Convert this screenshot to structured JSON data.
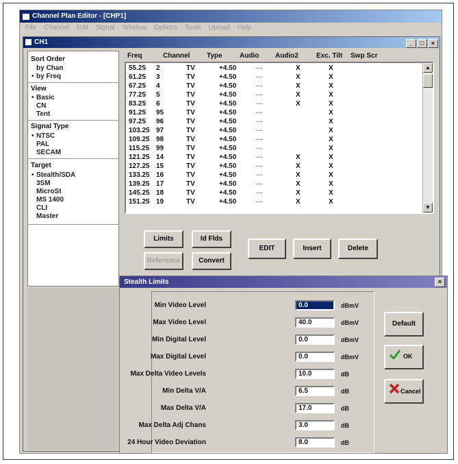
{
  "app": {
    "title": "Channel Plan Editor - [CHP1]",
    "menu": [
      "File",
      "Channel",
      "Edit",
      "Signal",
      "Window",
      "Options",
      "Tools",
      "Upload",
      "Help"
    ]
  },
  "child": {
    "title": "CH1"
  },
  "left_panel": {
    "sort_order": {
      "label": "Sort Order",
      "options": [
        "by Chan",
        "by Freq"
      ],
      "selected": "by Freq"
    },
    "view": {
      "label": "View",
      "options": [
        "Basic",
        "CN",
        "Tent"
      ],
      "selected": "Basic"
    },
    "signal_type": {
      "label": "Signal Type",
      "options": [
        "NTSC",
        "PAL",
        "SECAM"
      ],
      "selected": "NTSC"
    },
    "target": {
      "label": "Target",
      "options": [
        "Stealth/SDA",
        "3SM",
        "MicroSt",
        "MS 1400",
        "CLI",
        "Master"
      ],
      "selected": "Stealth/SDA"
    }
  },
  "table": {
    "columns": [
      "Freq",
      "Channel",
      "Type",
      "Audio",
      "Audio2",
      "Exc. Tilt",
      "Swp Scr"
    ],
    "rows": [
      [
        "55.25",
        "2",
        "TV",
        "+4.50",
        "---",
        "X",
        "X"
      ],
      [
        "61.25",
        "3",
        "TV",
        "+4.50",
        "---",
        "X",
        "X"
      ],
      [
        "67.25",
        "4",
        "TV",
        "+4.50",
        "---",
        "X",
        "X"
      ],
      [
        "77.25",
        "5",
        "TV",
        "+4.50",
        "---",
        "X",
        "X"
      ],
      [
        "83.25",
        "6",
        "TV",
        "+4.50",
        "---",
        "X",
        "X"
      ],
      [
        "91.25",
        "95",
        "TV",
        "+4.50",
        "---",
        "",
        "X"
      ],
      [
        "97.25",
        "96",
        "TV",
        "+4.50",
        "---",
        "",
        "X"
      ],
      [
        "103.25",
        "97",
        "TV",
        "+4.50",
        "---",
        "",
        "X"
      ],
      [
        "109.25",
        "98",
        "TV",
        "+4.50",
        "---",
        "",
        "X"
      ],
      [
        "115.25",
        "99",
        "TV",
        "+4.50",
        "---",
        "",
        "X"
      ],
      [
        "121.25",
        "14",
        "TV",
        "+4.50",
        "---",
        "X",
        "X"
      ],
      [
        "127.25",
        "15",
        "TV",
        "+4.50",
        "---",
        "X",
        "X"
      ],
      [
        "133.25",
        "16",
        "TV",
        "+4.50",
        "---",
        "X",
        "X"
      ],
      [
        "139.25",
        "17",
        "TV",
        "+4.50",
        "---",
        "X",
        "X"
      ],
      [
        "145.25",
        "18",
        "TV",
        "+4.50",
        "---",
        "X",
        "X"
      ],
      [
        "151.25",
        "19",
        "TV",
        "+4.50",
        "---",
        "X",
        "X"
      ]
    ]
  },
  "buttons": {
    "limits": "Limits",
    "id_fields": "Id Flds",
    "reference": "Reference",
    "convert": "Convert",
    "edit": "EDIT",
    "insert": "Insert",
    "delete": "Delete"
  },
  "dialog": {
    "title": "Stealth Limits",
    "fields": [
      {
        "label": "Min Video Level",
        "value": "0.0",
        "unit": "dBmV",
        "selected": true
      },
      {
        "label": "Max Video Level",
        "value": "40.0",
        "unit": "dBmV"
      },
      {
        "label": "Min Digital Level",
        "value": "0.0",
        "unit": "dBmV"
      },
      {
        "label": "Max Digital Level",
        "value": "0.0",
        "unit": "dBmV"
      },
      {
        "label": "Max Delta Video Levels",
        "value": "10.0",
        "unit": "dB"
      },
      {
        "label": "Min Delta V/A",
        "value": "6.5",
        "unit": "dB"
      },
      {
        "label": "Max Delta V/A",
        "value": "17.0",
        "unit": "dB"
      },
      {
        "label": "Max Delta Adj Chans",
        "value": "3.0",
        "unit": "dB"
      },
      {
        "label": "24 Hour Video Deviation",
        "value": "8.0",
        "unit": "dB"
      }
    ],
    "default_label": "Default",
    "ok_label": "OK",
    "cancel_label": "Cancel"
  },
  "colors": {
    "title_bar": "#0a246a",
    "dialog_title": "#3a3a8a",
    "ok_check": "#2e9a2e",
    "cancel_x": "#c02020"
  }
}
